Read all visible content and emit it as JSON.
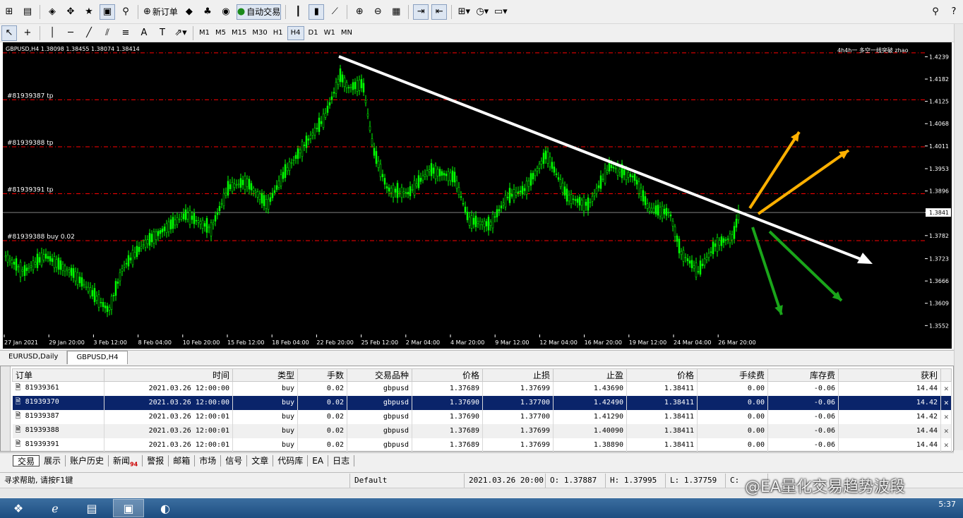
{
  "toolbar": {
    "new_order_label": "新订单",
    "auto_trade_label": "自动交易",
    "timeframes": [
      "M1",
      "M5",
      "M15",
      "M30",
      "H1",
      "H4",
      "D1",
      "W1",
      "MN"
    ],
    "active_timeframe": "H4"
  },
  "chart": {
    "header": "GBPUSD,H4  1.38098 1.38455 1.38074 1.38414",
    "ea_label": "4h4h一 多空一线突破  zhao",
    "current_price": "1.3841",
    "order_lines": [
      {
        "label": "#81939387 tp",
        "price": 1.4129
      },
      {
        "label": "#81939388 tp",
        "price": 1.4009
      },
      {
        "label": "#81939391 tp",
        "price": 1.3889
      },
      {
        "label": "#81939388 buy 0.02",
        "price": 1.3769
      }
    ],
    "top_line_price": 1.4249,
    "price_ticks": [
      "1.4239",
      "1.4182",
      "1.4125",
      "1.4068",
      "1.4011",
      "1.3953",
      "1.3896",
      "1.3841",
      "1.3782",
      "1.3723",
      "1.3666",
      "1.3609",
      "1.3552"
    ],
    "time_ticks": [
      "27 Jan 2021",
      "29 Jan 20:00",
      "3 Feb 12:00",
      "8 Feb 04:00",
      "10 Feb 20:00",
      "15 Feb 12:00",
      "18 Feb 04:00",
      "22 Feb 20:00",
      "25 Feb 12:00",
      "2 Mar 04:00",
      "4 Mar 20:00",
      "9 Mar 12:00",
      "12 Mar 04:00",
      "16 Mar 20:00",
      "19 Mar 12:00",
      "24 Mar 04:00",
      "26 Mar 20:00"
    ],
    "colors": {
      "bg": "#000000",
      "candle": "#00ff00",
      "order_line": "#ff0000",
      "trendline": "#ffffff",
      "bull_arrow": "#ffb000",
      "bear_arrow": "#1aa51a"
    }
  },
  "chart_tabs": [
    "EURUSD,Daily",
    "GBPUSD,H4"
  ],
  "active_chart_tab": "GBPUSD,H4",
  "orders": {
    "columns": [
      "订单",
      "时间",
      "类型",
      "手数",
      "交易品种",
      "价格",
      "止损",
      "止盈",
      "价格",
      "手续费",
      "库存费",
      "获利"
    ],
    "rows": [
      {
        "order": "81939361",
        "time": "2021.03.26 12:00:00",
        "type": "buy",
        "lots": "0.02",
        "symbol": "gbpusd",
        "price": "1.37689",
        "sl": "1.37699",
        "tp": "1.43690",
        "cur": "1.38411",
        "comm": "0.00",
        "swap": "-0.06",
        "profit": "14.44"
      },
      {
        "order": "81939370",
        "time": "2021.03.26 12:00:00",
        "type": "buy",
        "lots": "0.02",
        "symbol": "gbpusd",
        "price": "1.37690",
        "sl": "1.37700",
        "tp": "1.42490",
        "cur": "1.38411",
        "comm": "0.00",
        "swap": "-0.06",
        "profit": "14.42"
      },
      {
        "order": "81939387",
        "time": "2021.03.26 12:00:01",
        "type": "buy",
        "lots": "0.02",
        "symbol": "gbpusd",
        "price": "1.37690",
        "sl": "1.37700",
        "tp": "1.41290",
        "cur": "1.38411",
        "comm": "0.00",
        "swap": "-0.06",
        "profit": "14.42"
      },
      {
        "order": "81939388",
        "time": "2021.03.26 12:00:01",
        "type": "buy",
        "lots": "0.02",
        "symbol": "gbpusd",
        "price": "1.37689",
        "sl": "1.37699",
        "tp": "1.40090",
        "cur": "1.38411",
        "comm": "0.00",
        "swap": "-0.06",
        "profit": "14.44"
      },
      {
        "order": "81939391",
        "time": "2021.03.26 12:00:01",
        "type": "buy",
        "lots": "0.02",
        "symbol": "gbpusd",
        "price": "1.37689",
        "sl": "1.37699",
        "tp": "1.38890",
        "cur": "1.38411",
        "comm": "0.00",
        "swap": "-0.06",
        "profit": "14.44"
      }
    ]
  },
  "terminal_tabs": [
    "交易",
    "展示",
    "账户历史",
    "新闻",
    "警报",
    "邮箱",
    "市场",
    "信号",
    "文章",
    "代码库",
    "EA",
    "日志"
  ],
  "news_badge": "94",
  "status": {
    "help": "寻求帮助, 请按F1键",
    "profile": "Default",
    "bar_time": "2021.03.26 20:00",
    "open": "O: 1.37887",
    "high": "H: 1.37995",
    "low": "L: 1.37759",
    "close": "C:"
  },
  "watermark": "@EA量化交易趋势波段",
  "clock": "5:37"
}
